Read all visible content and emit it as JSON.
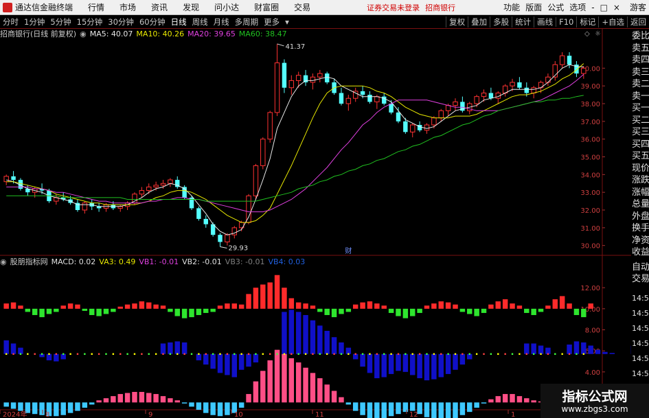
{
  "window": {
    "app_title": "通达信金融终端",
    "menus": [
      "行情",
      "市场",
      "资讯",
      "发现",
      "问小达",
      "财富圈",
      "交易"
    ],
    "notice_login": "证券交易未登录",
    "notice_stock": "招商银行",
    "right_menus": [
      "功能",
      "版面",
      "公式",
      "选项"
    ],
    "guest": "游客",
    "controls": [
      "-",
      "□",
      "×"
    ]
  },
  "toolbar": {
    "periods": [
      "分时",
      "1分钟",
      "5分钟",
      "15分钟",
      "30分钟",
      "60分钟",
      "日线",
      "周线",
      "月线",
      "多周期",
      "更多"
    ],
    "active_period": "日线",
    "right_tools": [
      "复权",
      "叠加",
      "多股",
      "统计",
      "画线",
      "F10",
      "标记",
      "+自选",
      "返回"
    ]
  },
  "main_chart": {
    "stock_label": "招商银行(日线 前复权)",
    "ma": [
      {
        "label": "MA5: 40.07",
        "color": "#e8e8e8"
      },
      {
        "label": "MA10: 40.26",
        "color": "#e8e800"
      },
      {
        "label": "MA20: 39.65",
        "color": "#e040e0"
      },
      {
        "label": "MA60: 38.47",
        "color": "#20c020"
      }
    ],
    "high_label": "41.37",
    "low_label": "29.93",
    "event_label": "财"
  },
  "indicator": {
    "name": "股朋指标网",
    "values": [
      {
        "label": "MACD: 0.02",
        "color": "#e0e0e0"
      },
      {
        "label": "VA3: 0.49",
        "color": "#e8e800"
      },
      {
        "label": "VB1: -0.01",
        "color": "#e040e0"
      },
      {
        "label": "VB2: -0.01",
        "color": "#e0e0e0"
      },
      {
        "label": "VB3: -0.01",
        "color": "#808080"
      },
      {
        "label": "VB4: 0.03",
        "color": "#2060e0"
      }
    ]
  },
  "right_panel": {
    "labels": [
      "委比",
      "卖五",
      "卖四",
      "卖三",
      "卖二",
      "卖一",
      "买一",
      "买二",
      "买三",
      "买四",
      "买五",
      "现价",
      "涨跌",
      "涨幅",
      "总量",
      "外盘",
      "换手",
      "净资",
      "收益",
      "自动",
      "交易",
      "14:56",
      "14:56",
      "14:56",
      "14:56",
      "14:56",
      "14:56",
      "14:56",
      "14:56"
    ]
  },
  "watermark": {
    "title": "指标公式网",
    "url": "www.zbgs3.com"
  },
  "chart_data": [
    {
      "type": "candlestick",
      "title": "招商银行(日线 前复权)",
      "y_axis": [
        40.0,
        39.0,
        38.0,
        37.0,
        36.0,
        35.0,
        34.0,
        33.0,
        32.0,
        31.0,
        30.0
      ],
      "ylim": [
        29.6,
        41.6
      ],
      "x_axis": [
        "2024年",
        "8",
        "9",
        "10",
        "11",
        "12",
        "1"
      ],
      "up_color": "#ff3232",
      "down_color": "#54ffff",
      "candles": [
        [
          33.6,
          34.0,
          33.4,
          33.9
        ],
        [
          33.9,
          34.2,
          33.5,
          33.7
        ],
        [
          33.7,
          33.8,
          33.1,
          33.2
        ],
        [
          33.2,
          33.4,
          32.8,
          33.0
        ],
        [
          33.0,
          33.3,
          32.7,
          33.2
        ],
        [
          33.2,
          33.5,
          32.9,
          33.1
        ],
        [
          33.1,
          33.2,
          32.4,
          32.5
        ],
        [
          32.5,
          32.9,
          32.3,
          32.7
        ],
        [
          32.7,
          33.0,
          32.5,
          32.6
        ],
        [
          32.6,
          32.8,
          32.3,
          32.4
        ],
        [
          32.4,
          32.6,
          31.9,
          32.0
        ],
        [
          32.0,
          32.5,
          31.8,
          32.4
        ],
        [
          32.4,
          32.6,
          32.0,
          32.2
        ],
        [
          32.2,
          32.4,
          31.9,
          32.1
        ],
        [
          32.1,
          32.4,
          31.9,
          32.3
        ],
        [
          32.3,
          32.5,
          32.0,
          32.1
        ],
        [
          32.1,
          32.3,
          31.9,
          32.2
        ],
        [
          32.2,
          32.5,
          32.0,
          32.4
        ],
        [
          32.4,
          33.0,
          32.3,
          32.9
        ],
        [
          32.9,
          33.3,
          32.7,
          33.1
        ],
        [
          33.1,
          33.5,
          32.9,
          33.3
        ],
        [
          33.3,
          33.6,
          33.1,
          33.4
        ],
        [
          33.4,
          33.7,
          33.2,
          33.5
        ],
        [
          33.5,
          33.8,
          33.3,
          33.7
        ],
        [
          33.7,
          33.9,
          33.2,
          33.3
        ],
        [
          33.3,
          33.4,
          32.6,
          32.7
        ],
        [
          32.7,
          32.8,
          32.0,
          32.1
        ],
        [
          32.1,
          32.2,
          31.4,
          31.5
        ],
        [
          31.5,
          31.7,
          31.0,
          31.2
        ],
        [
          31.2,
          31.3,
          30.5,
          30.6
        ],
        [
          30.6,
          30.7,
          29.93,
          30.2
        ],
        [
          30.2,
          30.7,
          30.0,
          30.6
        ],
        [
          30.6,
          31.1,
          30.4,
          31.0
        ],
        [
          31.0,
          31.4,
          30.8,
          31.3
        ],
        [
          31.3,
          32.9,
          31.2,
          32.8
        ],
        [
          32.8,
          34.6,
          32.6,
          34.5
        ],
        [
          34.5,
          36.1,
          34.3,
          36.0
        ],
        [
          36.0,
          37.6,
          35.8,
          37.5
        ],
        [
          37.5,
          41.37,
          37.3,
          40.3
        ],
        [
          40.3,
          40.5,
          38.6,
          38.9
        ],
        [
          38.9,
          39.6,
          38.5,
          39.3
        ],
        [
          39.3,
          39.8,
          38.9,
          39.6
        ],
        [
          39.6,
          39.9,
          39.0,
          39.2
        ],
        [
          39.2,
          39.7,
          38.8,
          39.5
        ],
        [
          39.5,
          39.9,
          39.2,
          39.7
        ],
        [
          39.7,
          39.8,
          39.1,
          39.2
        ],
        [
          39.2,
          39.4,
          38.5,
          38.6
        ],
        [
          38.6,
          38.9,
          37.9,
          38.0
        ],
        [
          38.0,
          38.5,
          37.6,
          38.3
        ],
        [
          38.3,
          38.9,
          38.1,
          38.7
        ],
        [
          38.7,
          39.0,
          38.3,
          38.5
        ],
        [
          38.5,
          38.7,
          38.0,
          38.1
        ],
        [
          38.1,
          38.5,
          37.7,
          38.4
        ],
        [
          38.4,
          38.6,
          37.9,
          38.0
        ],
        [
          38.0,
          38.2,
          37.4,
          37.5
        ],
        [
          37.5,
          37.8,
          36.9,
          37.0
        ],
        [
          37.0,
          37.2,
          36.3,
          36.4
        ],
        [
          36.4,
          36.9,
          36.1,
          36.8
        ],
        [
          36.8,
          37.0,
          36.4,
          36.5
        ],
        [
          36.5,
          36.9,
          36.3,
          36.8
        ],
        [
          36.8,
          37.3,
          36.6,
          37.2
        ],
        [
          37.2,
          37.7,
          37.0,
          37.6
        ],
        [
          37.6,
          38.0,
          37.3,
          37.9
        ],
        [
          37.9,
          38.3,
          37.6,
          38.1
        ],
        [
          38.1,
          38.4,
          37.5,
          37.6
        ],
        [
          37.6,
          38.1,
          37.4,
          38.0
        ],
        [
          38.0,
          38.5,
          37.8,
          38.4
        ],
        [
          38.4,
          38.8,
          38.1,
          38.6
        ],
        [
          38.6,
          38.9,
          38.2,
          38.3
        ],
        [
          38.3,
          38.7,
          38.0,
          38.6
        ],
        [
          38.6,
          39.1,
          38.4,
          39.0
        ],
        [
          39.0,
          39.4,
          38.7,
          39.2
        ],
        [
          39.2,
          39.5,
          38.8,
          38.9
        ],
        [
          38.9,
          39.2,
          38.4,
          38.6
        ],
        [
          38.6,
          39.0,
          38.3,
          38.9
        ],
        [
          38.9,
          39.3,
          38.6,
          39.2
        ],
        [
          39.2,
          39.7,
          39.0,
          39.5
        ],
        [
          39.5,
          40.4,
          39.3,
          40.2
        ],
        [
          40.2,
          40.9,
          40.0,
          40.7
        ],
        [
          40.7,
          40.9,
          40.0,
          40.2
        ],
        [
          40.2,
          40.4,
          39.5,
          39.7
        ],
        [
          39.7,
          40.1,
          39.4,
          40.0
        ]
      ],
      "ma_series": [
        {
          "name": "MA5",
          "color": "#e8e8e8",
          "values": [
            33.7,
            33.6,
            33.4,
            33.2,
            33.1,
            33.0,
            32.8,
            32.7,
            32.6,
            32.5,
            32.3,
            32.3,
            32.3,
            32.2,
            32.2,
            32.2,
            32.2,
            32.3,
            32.5,
            32.7,
            33.0,
            33.2,
            33.3,
            33.5,
            33.4,
            33.2,
            32.8,
            32.3,
            31.8,
            31.2,
            30.8,
            30.6,
            30.7,
            30.9,
            31.6,
            32.6,
            33.7,
            34.9,
            36.6,
            37.5,
            38.4,
            39.0,
            39.3,
            39.3,
            39.4,
            39.5,
            39.4,
            39.0,
            38.8,
            38.6,
            38.4,
            38.4,
            38.4,
            38.3,
            38.1,
            37.6,
            37.1,
            36.9,
            36.7,
            36.6,
            36.7,
            37.0,
            37.3,
            37.6,
            37.7,
            37.8,
            37.9,
            38.2,
            38.3,
            38.4,
            38.6,
            38.8,
            38.8,
            38.8,
            38.8,
            38.9,
            39.2,
            39.6,
            40.0,
            40.2,
            40.1,
            40.07
          ]
        },
        {
          "name": "MA10",
          "color": "#e8e800",
          "values": [
            33.6,
            33.6,
            33.5,
            33.4,
            33.3,
            33.2,
            33.1,
            32.9,
            32.8,
            32.7,
            32.6,
            32.5,
            32.4,
            32.4,
            32.3,
            32.3,
            32.3,
            32.3,
            32.3,
            32.4,
            32.5,
            32.7,
            32.8,
            33.0,
            33.1,
            33.1,
            33.0,
            32.8,
            32.6,
            32.3,
            32.0,
            31.7,
            31.5,
            31.3,
            31.3,
            31.4,
            31.7,
            32.1,
            32.9,
            33.7,
            34.5,
            35.4,
            36.3,
            37.2,
            38.0,
            38.6,
            38.9,
            39.0,
            39.0,
            39.0,
            39.0,
            38.9,
            38.7,
            38.6,
            38.4,
            38.1,
            37.8,
            37.6,
            37.4,
            37.3,
            37.2,
            37.2,
            37.2,
            37.3,
            37.3,
            37.3,
            37.4,
            37.6,
            37.8,
            38.0,
            38.2,
            38.4,
            38.5,
            38.5,
            38.6,
            38.7,
            38.9,
            39.1,
            39.4,
            39.6,
            39.9,
            40.26
          ]
        },
        {
          "name": "MA20",
          "color": "#e040e0",
          "values": [
            33.3,
            33.3,
            33.3,
            33.3,
            33.2,
            33.2,
            33.1,
            33.0,
            33.0,
            32.9,
            32.8,
            32.7,
            32.6,
            32.5,
            32.5,
            32.4,
            32.4,
            32.4,
            32.4,
            32.4,
            32.5,
            32.5,
            32.6,
            32.6,
            32.7,
            32.7,
            32.6,
            32.6,
            32.5,
            32.4,
            32.3,
            32.2,
            32.1,
            32.0,
            31.9,
            31.9,
            31.9,
            32.0,
            32.2,
            32.4,
            32.6,
            32.9,
            33.2,
            33.6,
            34.0,
            34.4,
            34.9,
            35.4,
            35.8,
            36.3,
            36.8,
            37.1,
            37.5,
            37.8,
            38.0,
            38.2,
            38.2,
            38.2,
            38.2,
            38.2,
            38.1,
            38.0,
            37.9,
            37.8,
            37.8,
            37.7,
            37.6,
            37.6,
            37.6,
            37.6,
            37.7,
            37.8,
            37.9,
            38.0,
            38.1,
            38.2,
            38.4,
            38.6,
            38.8,
            39.0,
            39.3,
            39.65
          ]
        },
        {
          "name": "MA60",
          "color": "#20c020",
          "values": [
            32.8,
            32.8,
            32.8,
            32.8,
            32.8,
            32.8,
            32.8,
            32.8,
            32.7,
            32.7,
            32.7,
            32.7,
            32.7,
            32.7,
            32.7,
            32.7,
            32.7,
            32.6,
            32.6,
            32.6,
            32.6,
            32.6,
            32.6,
            32.6,
            32.6,
            32.6,
            32.6,
            32.6,
            32.5,
            32.5,
            32.5,
            32.5,
            32.5,
            32.5,
            32.5,
            32.5,
            32.6,
            32.7,
            32.8,
            32.9,
            33.0,
            33.2,
            33.3,
            33.4,
            33.6,
            33.7,
            33.9,
            34.0,
            34.2,
            34.3,
            34.5,
            34.6,
            34.8,
            34.9,
            35.1,
            35.3,
            35.4,
            35.6,
            35.7,
            35.9,
            36.1,
            36.2,
            36.4,
            36.6,
            36.8,
            36.9,
            37.1,
            37.3,
            37.4,
            37.6,
            37.7,
            37.8,
            37.9,
            38.0,
            38.1,
            38.1,
            38.2,
            38.2,
            38.3,
            38.3,
            38.4,
            38.47
          ]
        }
      ]
    },
    {
      "type": "bar",
      "title": "股朋指标网",
      "y_axis": [
        12.0,
        10.0,
        8.0,
        6.0,
        4.0,
        2.0
      ],
      "ylim": [
        0.6,
        13.9
      ],
      "red_green_base": 10.0,
      "red_green": [
        0.5,
        0.6,
        0.3,
        -0.3,
        -0.6,
        -0.8,
        -0.5,
        -0.3,
        0.3,
        0.5,
        0.4,
        -0.2,
        -0.6,
        -0.7,
        -0.5,
        -0.3,
        0.2,
        0.4,
        0.5,
        0.7,
        0.6,
        0.4,
        0.3,
        -0.3,
        -0.7,
        -0.9,
        -0.8,
        -0.6,
        -0.4,
        -0.3,
        0.3,
        0.5,
        0.5,
        0.4,
        1.4,
        2.0,
        2.3,
        2.5,
        3.2,
        2.0,
        1.0,
        0.6,
        0.5,
        0.3,
        -0.3,
        -0.6,
        -0.8,
        -0.5,
        -0.3,
        0.4,
        0.6,
        0.7,
        0.5,
        0.3,
        -0.4,
        -0.7,
        -0.9,
        -0.7,
        -0.4,
        0.3,
        0.5,
        0.7,
        0.6,
        0.4,
        -0.3,
        -0.5,
        -0.7,
        -0.4,
        0.4,
        0.7,
        0.9,
        0.5,
        0.3,
        -0.4,
        -0.6,
        -0.3,
        0.3,
        0.9,
        1.2,
        0.5,
        -0.6,
        -0.8,
        0.5
      ],
      "blue_base": 5.7,
      "blue": [
        1.3,
        1.0,
        0.6,
        0,
        0,
        -0.3,
        -0.6,
        -0.7,
        -0.5,
        0,
        0,
        0,
        0,
        0,
        0,
        0,
        0,
        0,
        0,
        0,
        0,
        0,
        1.0,
        1.1,
        1.2,
        1.1,
        0,
        -0.6,
        -1.0,
        -1.4,
        -1.8,
        -2.0,
        -2.2,
        -1.5,
        -1.2,
        -0.8,
        0,
        0,
        0,
        4.0,
        4.2,
        4.0,
        3.7,
        3.2,
        2.7,
        2.2,
        1.6,
        1.1,
        0.6,
        -0.5,
        -1.2,
        -1.8,
        -2.3,
        -2.2,
        -1.9,
        -1.6,
        -1.7,
        -2.0,
        -2.3,
        -2.5,
        -2.4,
        -2.2,
        -1.9,
        -1.5,
        -1.0,
        -0.5,
        0,
        0,
        0,
        0,
        0,
        0,
        0,
        1.0,
        1.0,
        0.8,
        0.6,
        0,
        0,
        0.9,
        1.2,
        1.1,
        0.8,
        0.4,
        0.2,
        0.1,
        0,
        0,
        0.8,
        0.7,
        0.4,
        0.3
      ],
      "cyan_pink_base": 1.1,
      "cyan_pink": [
        -0.4,
        -0.6,
        -0.8,
        -1.0,
        -1.1,
        -1.2,
        -1.3,
        -1.3,
        -1.2,
        -1.0,
        -0.8,
        -0.5,
        -0.2,
        0.2,
        0.4,
        0.6,
        0.8,
        0.9,
        1.0,
        1.0,
        0.9,
        0.8,
        0.6,
        0.4,
        0.2,
        -0.1,
        -0.4,
        -0.7,
        -1.0,
        -1.2,
        -1.3,
        -1.2,
        -1.0,
        -0.5,
        0.8,
        2.0,
        3.0,
        4.0,
        5.0,
        4.6,
        4.2,
        3.8,
        3.3,
        2.8,
        2.3,
        1.7,
        1.1,
        0.5,
        -0.2,
        -0.8,
        -1.2,
        -1.5,
        -1.6,
        -1.5,
        -1.3,
        -1.1,
        -0.9,
        -0.8,
        -1.1,
        -1.4,
        -1.6,
        -1.7,
        -1.7,
        -1.5,
        -1.2,
        -0.9,
        -0.5,
        -0.1,
        0.3,
        0.6,
        0.8,
        0.8,
        0.6,
        0.4,
        0.2,
        0.1,
        0.3,
        0.5,
        0.6,
        0.4,
        0.0,
        -0.3,
        -0.5,
        -0.6
      ]
    }
  ]
}
